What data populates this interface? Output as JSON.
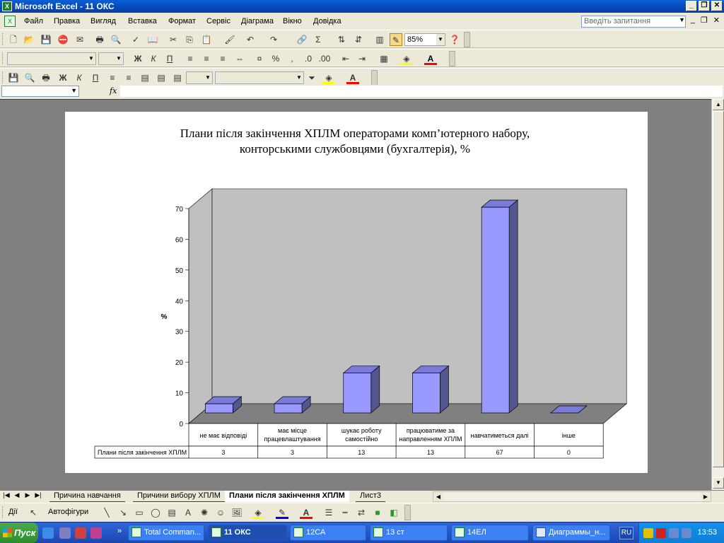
{
  "window": {
    "title": "Microsoft Excel - 11 ОКС"
  },
  "menu": {
    "items": [
      "Файл",
      "Правка",
      "Вигляд",
      "Вставка",
      "Формат",
      "Сервіс",
      "Діаграма",
      "Вікно",
      "Довідка"
    ],
    "help_placeholder": "Введіть запитання"
  },
  "toolbar": {
    "zoom": "85%"
  },
  "chart": {
    "title_line1": "Плани після закінчення ХПЛМ операторами комп’ютерного набору,",
    "title_line2": "конторськими службовцями (бухгалтерія), %"
  },
  "chart_data": {
    "type": "bar",
    "title": "Плани після закінчення ХПЛМ операторами комп’ютерного набору, конторськими службовцями (бухгалтерія), %",
    "xlabel": "",
    "ylabel": "%",
    "ylim": [
      0,
      70
    ],
    "yticks": [
      0,
      10,
      20,
      30,
      40,
      50,
      60,
      70
    ],
    "categories": [
      [
        "не має відповіді"
      ],
      [
        "має місце",
        "працевлаштування"
      ],
      [
        "шукає роботу",
        "самостійно"
      ],
      [
        "працюватиме за",
        "направленням ХПЛМ"
      ],
      [
        "навчатиметься далі"
      ],
      [
        "інше"
      ]
    ],
    "series": [
      {
        "name": "Плани після закінчення ХПЛМ",
        "values": [
          3,
          3,
          13,
          13,
          67,
          0
        ]
      }
    ],
    "data_table": true,
    "bar_color": "#9999ff",
    "wall_color": "#c0c0c0",
    "floor_color": "#808080"
  },
  "sheet_tabs": [
    "Причина навчання",
    "Причини вибору ХПЛМ",
    "Плани після закінчення ХПЛМ",
    "Лист3"
  ],
  "active_tab": 2,
  "drawing": {
    "actions": "Дії",
    "autoshapes": "Автофігури"
  },
  "taskbar": {
    "start": "Пуск",
    "buttons": [
      "Total Comman...",
      "11 ОКС",
      "12СА",
      "13 ст",
      "14ЕЛ",
      "Диаграммы_н..."
    ],
    "lang": "RU",
    "clock": "13:53"
  }
}
